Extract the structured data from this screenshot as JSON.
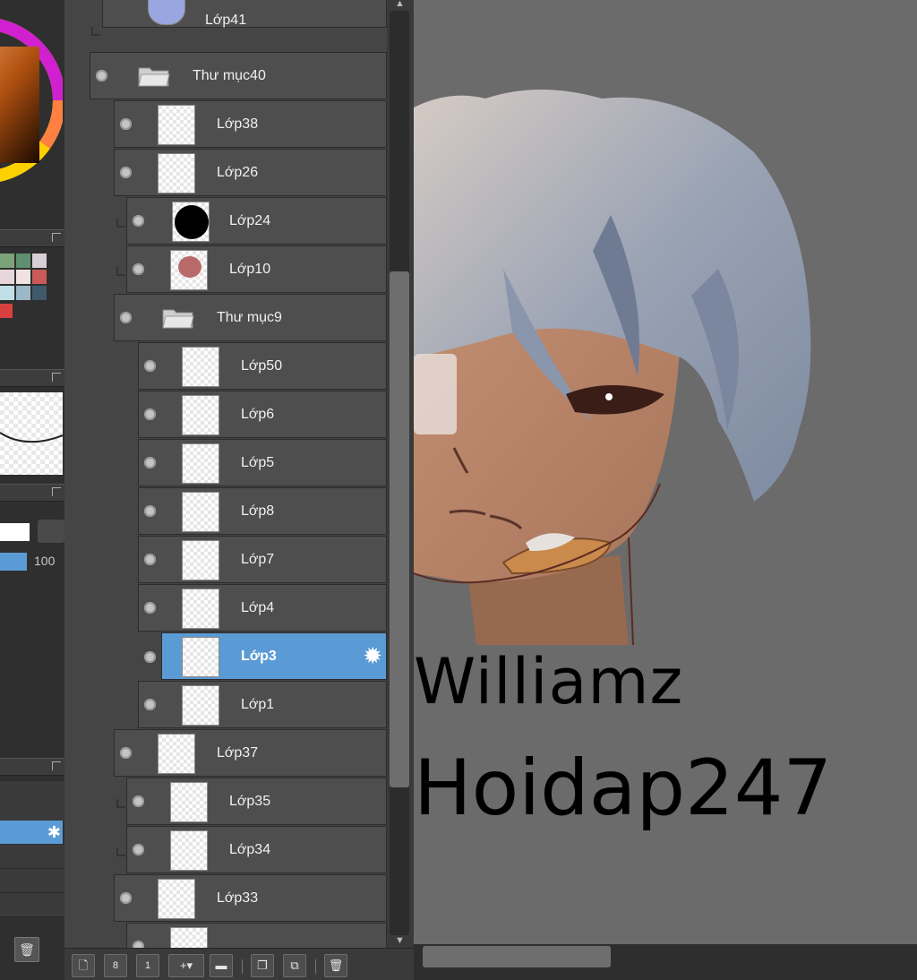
{
  "left_panel": {
    "opacity_value": "100"
  },
  "layers": [
    {
      "name": "Lớp41"
    },
    {
      "name": "Thư mục40"
    },
    {
      "name": "Lớp38"
    },
    {
      "name": "Lớp26"
    },
    {
      "name": "Lớp24"
    },
    {
      "name": "Lớp10"
    },
    {
      "name": "Thư mục9"
    },
    {
      "name": "Lớp50"
    },
    {
      "name": "Lớp6"
    },
    {
      "name": "Lớp5"
    },
    {
      "name": "Lớp8"
    },
    {
      "name": "Lớp7"
    },
    {
      "name": "Lớp4"
    },
    {
      "name": "Lớp3"
    },
    {
      "name": "Lớp1"
    },
    {
      "name": "Lớp37"
    },
    {
      "name": "Lớp35"
    },
    {
      "name": "Lớp34"
    },
    {
      "name": "Lớp33"
    }
  ],
  "selected_layer": "Lớp3",
  "toolbar": {
    "icons": [
      "new-layer-icon",
      "new-raster-layer-icon",
      "new-1bit-layer-icon",
      "add-layer-dropdown-icon",
      "new-folder-icon",
      "duplicate-layer-icon",
      "merge-layer-icon",
      "delete-layer-icon"
    ]
  },
  "canvas": {
    "signature_line1": "Williamz",
    "signature_line2": "Hoidap247"
  },
  "colors": {
    "selection_blue": "#5b9bd5",
    "panel_gray": "#4e4e4e",
    "canvas_gray": "#6b6b6b"
  }
}
